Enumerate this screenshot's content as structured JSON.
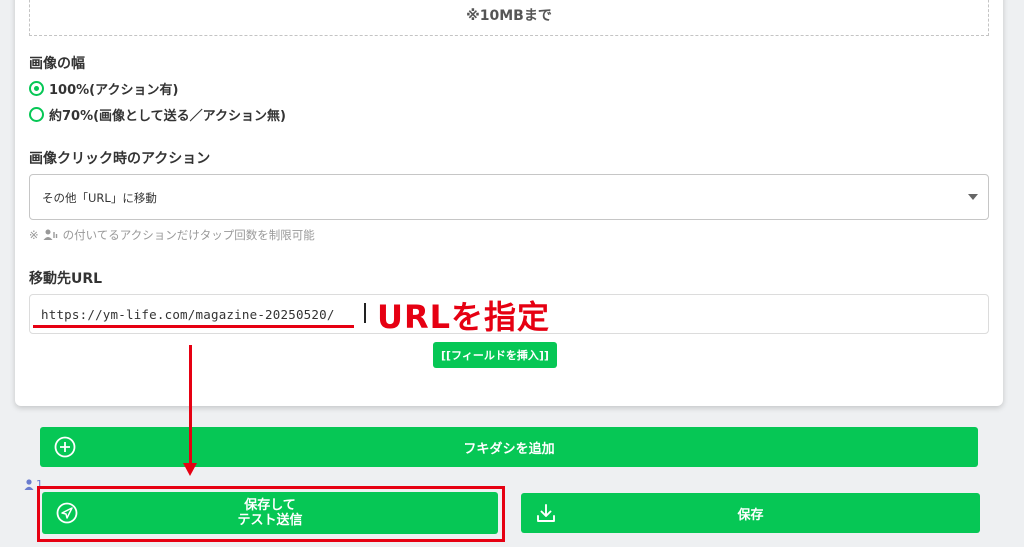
{
  "upload": {
    "note": "※10MBまで"
  },
  "image_width": {
    "label": "画像の幅",
    "options": [
      {
        "label": "100%(アクション有)",
        "checked": true
      },
      {
        "label": "約70%(画像として送る／アクション無)",
        "checked": false
      }
    ]
  },
  "action": {
    "label": "画像クリック時のアクション",
    "selected": "その他「URL」に移動",
    "hint_prefix": "※",
    "hint_text": "の付いてるアクションだけタップ回数を制限可能"
  },
  "destination": {
    "label": "移動先URL",
    "value": "https://ym-life.com/magazine-20250520/",
    "insert_field_label": "[[フィールドを挿入]]"
  },
  "buttons": {
    "add_bubble": "フキダシを追加",
    "save_and_test_line1": "保存して",
    "save_and_test_line2": "テスト送信",
    "save": "保存"
  },
  "count": "1",
  "annotation": {
    "text": "URLを指定"
  },
  "colors": {
    "primary": "#06c755",
    "annotation": "#e60012"
  }
}
